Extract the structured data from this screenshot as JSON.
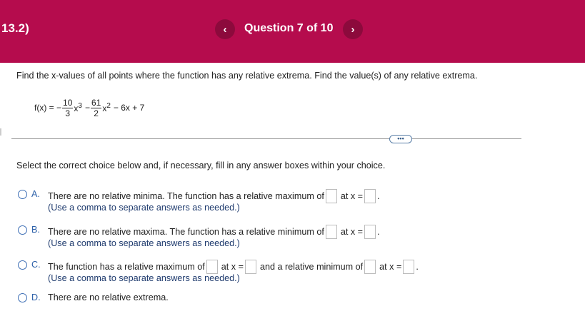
{
  "header": {
    "section": "13.2)",
    "question_title": "Question 7 of 10",
    "prev_glyph": "‹",
    "next_glyph": "›",
    "bg_color": "#b50c4d"
  },
  "prompt": "Find the x-values of all points where the function has any relative extrema. Find the value(s) of any relative extrema.",
  "formula": {
    "lhs": "f(x) = −",
    "frac1_num": "10",
    "frac1_den": "3",
    "x": "x",
    "exp1": "3",
    "minus": "−",
    "frac2_num": "61",
    "frac2_den": "2",
    "exp2": "2",
    "tail": "− 6x + 7"
  },
  "more_button": "•••",
  "instruction": "Select the correct choice below and, if necessary, fill in any answer boxes within your choice.",
  "choices": {
    "a": {
      "letter": "A.",
      "text1": "There are no relative minima. The function has a relative maximum of",
      "text2": "at x =",
      "note": "(Use a comma to separate answers as needed.)"
    },
    "b": {
      "letter": "B.",
      "text1": "There are no relative maxima. The function has a relative minimum of",
      "text2": "at x =",
      "note": "(Use a comma to separate answers as needed.)"
    },
    "c": {
      "letter": "C.",
      "text1": "The function has a relative maximum of",
      "text2": "at x =",
      "text3": "and a relative minimum of",
      "text4": "at x =",
      "note": "(Use a comma to separate answers as needed.)"
    },
    "d": {
      "letter": "D.",
      "text1": "There are no relative extrema."
    }
  }
}
